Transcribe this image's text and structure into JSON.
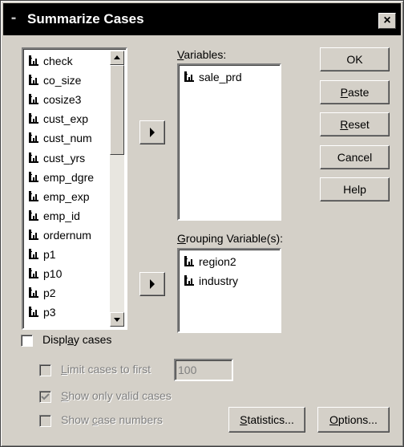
{
  "window": {
    "title": "Summarize Cases",
    "close_glyph": "×"
  },
  "source_list": {
    "items": [
      "check",
      "co_size",
      "cosize3",
      "cust_exp",
      "cust_num",
      "cust_yrs",
      "emp_dgre",
      "emp_exp",
      "emp_id",
      "ordernum",
      "p1",
      "p10",
      "p2",
      "p3"
    ]
  },
  "variables": {
    "label_pre": "",
    "label_ul": "V",
    "label_post": "ariables:",
    "items": [
      "sale_prd"
    ]
  },
  "grouping": {
    "label_pre": "",
    "label_ul": "G",
    "label_post": "rouping Variable(s):",
    "items": [
      "region2",
      "industry"
    ]
  },
  "buttons": {
    "ok": "OK",
    "paste_ul": "P",
    "paste_rest": "aste",
    "reset_ul": "R",
    "reset_rest": "eset",
    "cancel": "Cancel",
    "help": "Help",
    "statistics_ul": "S",
    "statistics_rest": "tatistics...",
    "options_ul": "O",
    "options_rest": "ptions..."
  },
  "display_cases": {
    "pre": "Displ",
    "ul": "a",
    "post": "y cases",
    "checked": false
  },
  "limit_cases": {
    "pre": "",
    "ul": "L",
    "post": "imit cases to first",
    "value": "100",
    "checked": false
  },
  "show_valid": {
    "pre": "",
    "ul": "S",
    "post": "how only valid cases",
    "checked": true
  },
  "show_case_numbers": {
    "pre": "Show ",
    "ul": "c",
    "post": "ase numbers",
    "checked": false
  },
  "icons": {
    "variable": "scale-variable-icon",
    "arrow": "right-arrow-icon",
    "check": "checkmark-icon"
  }
}
